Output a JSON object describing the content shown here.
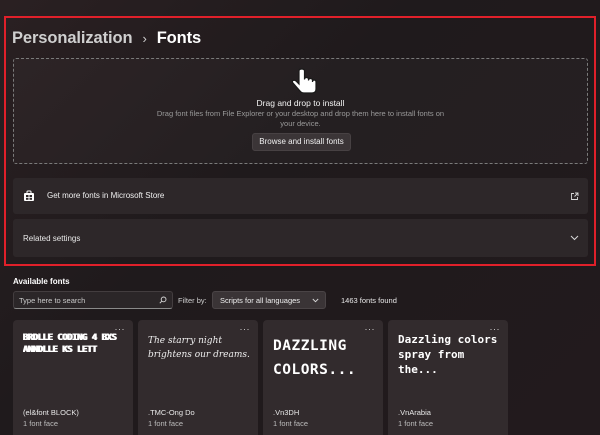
{
  "breadcrumb": {
    "parent": "Personalization",
    "separator": "›",
    "current": "Fonts"
  },
  "dropzone": {
    "title": "Drag and drop to install",
    "description": "Drag font files from File Explorer or your desktop and drop them here to install fonts on your device.",
    "button_label": "Browse and install fonts",
    "icon": "hand-drag-icon"
  },
  "store_card": {
    "label": "Get more fonts in Microsoft Store",
    "icon": "store-icon",
    "action_icon": "external-link-icon"
  },
  "related_card": {
    "label": "Related settings",
    "action_icon": "chevron-down-icon"
  },
  "available": {
    "title": "Available fonts",
    "search_placeholder": "Type here to search",
    "search_value": "",
    "filter_label": "Filter by:",
    "filter_value": "Scripts for all languages",
    "count": "1463 fonts found"
  },
  "fonts": [
    {
      "preview": "BRDLLE CODING 4 BXS ANNDLLE KS LETT",
      "name": "(el&font BLOCK)",
      "faces": "1 font face",
      "more": "···"
    },
    {
      "preview": "The starry night brightens our dreams.",
      "name": ".TMC-Ong Do",
      "faces": "1 font face",
      "more": "···"
    },
    {
      "preview": "DAZZLING COLORS...",
      "name": ".Vn3DH",
      "faces": "1 font face",
      "more": "···"
    },
    {
      "preview": "Dazzling colors spray from the...",
      "name": ".VnArabia",
      "faces": "1 font face",
      "more": "···"
    }
  ],
  "colors": {
    "highlight": "#e0202a",
    "background": "#221c1e",
    "card": "#2d2729"
  }
}
